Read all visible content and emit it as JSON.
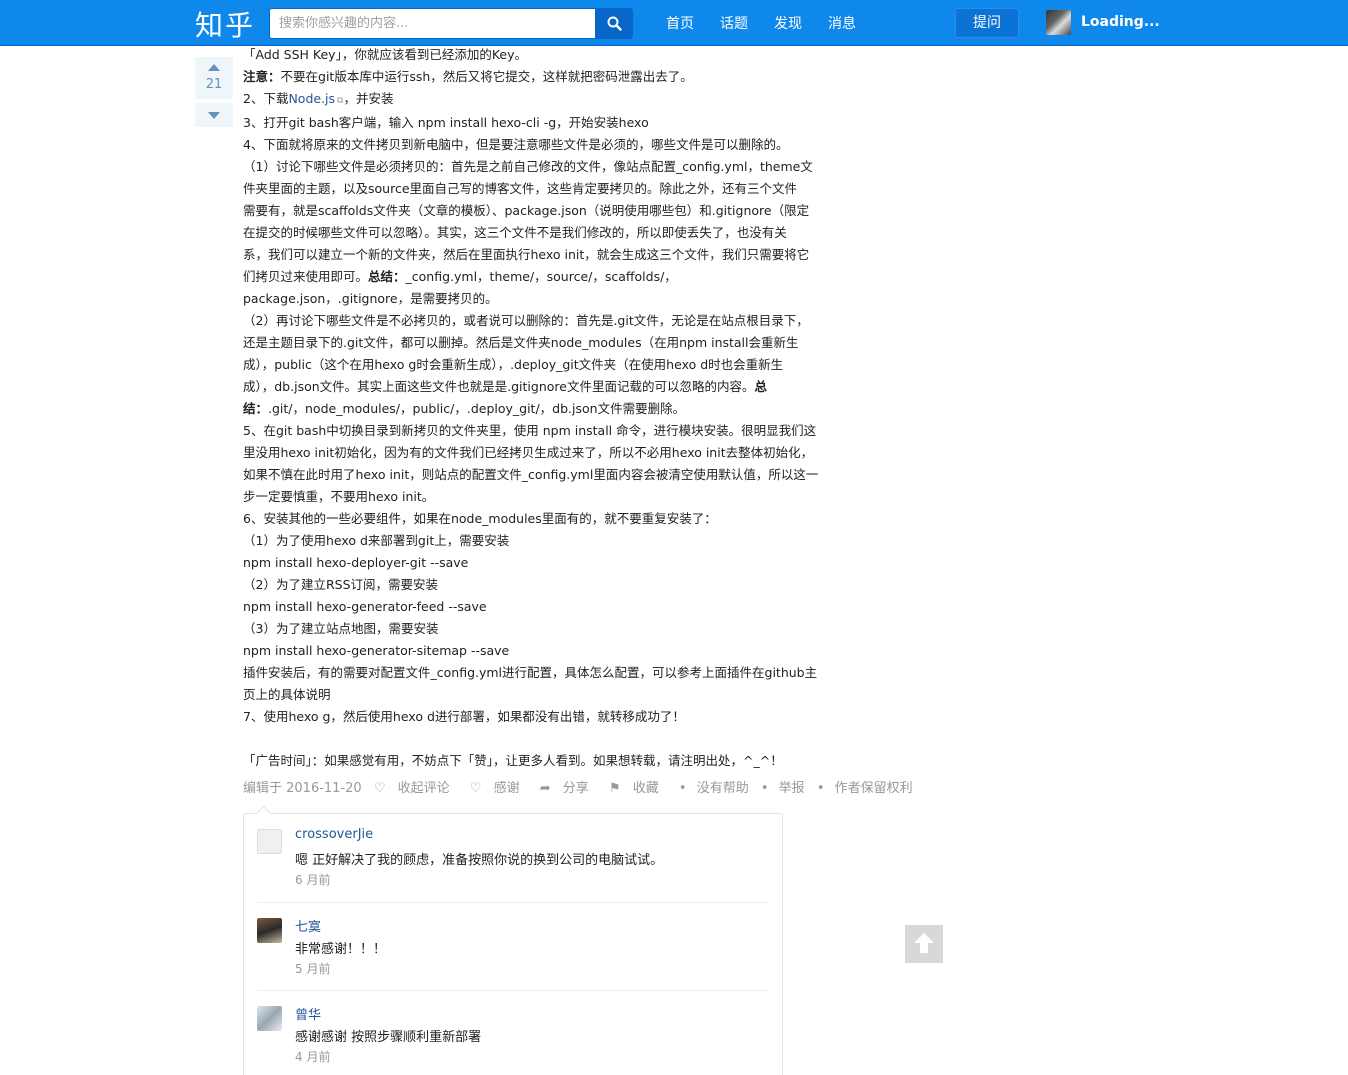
{
  "header": {
    "logo": "知乎",
    "search_placeholder": "搜索你感兴趣的内容...",
    "nav": [
      "首页",
      "话题",
      "发现",
      "消息"
    ],
    "ask_label": "提问",
    "user_name": "Loading...",
    "accent": "#0f88eb"
  },
  "vote": {
    "count": "21"
  },
  "article": {
    "l1": "「Add SSH Key」，你就应该看到已经添加的Key。",
    "l2_bold": "注意：",
    "l2": "不要在git版本库中运行ssh，然后又将它提交，这样就把密码泄露出去了。",
    "l3_pre": "2、下载",
    "l3_link": "Node.js",
    "l3_post": "，并安装",
    "l4": "3、打开git bash客户端，输入 npm install hexo-cli -g，开始安装hexo",
    "l5": "4、下面就将原来的文件拷贝到新电脑中，但是要注意哪些文件是必须的，哪些文件是可以删除的。",
    "l6": "（1）讨论下哪些文件是必须拷贝的：首先是之前自己修改的文件，像站点配置_config.yml，theme文",
    "l7": "件夹里面的主题，以及source里面自己写的博客文件，这些肯定要拷贝的。除此之外，还有三个文件",
    "l8": "需要有，就是scaffolds文件夹（文章的模板）、package.json（说明使用哪些包）和.gitignore（限定",
    "l9": "在提交的时候哪些文件可以忽略）。其实，这三个文件不是我们修改的，所以即使丢失了，也没有关",
    "l10": "系，我们可以建立一个新的文件夹，然后在里面执行hexo init，就会生成这三个文件，我们只需要将它",
    "l11_pre": "们拷贝过来使用即可。",
    "l11_bold": "总结：",
    "l11_post": "_config.yml，theme/，source/，scaffolds/，",
    "l12": "package.json，.gitignore，是需要拷贝的。",
    "l13": "（2）再讨论下哪些文件是不必拷贝的，或者说可以删除的：首先是.git文件，无论是在站点根目录下，",
    "l14": "还是主题目录下的.git文件，都可以删掉。然后是文件夹node_modules（在用npm install会重新生",
    "l15": "成），public（这个在用hexo g时会重新生成），.deploy_git文件夹（在使用hexo d时也会重新生",
    "l16_pre": "成），db.json文件。其实上面这些文件也就是是.gitignore文件里面记载的可以忽略的内容。",
    "l16_bold": "总",
    "l17_bold": "结：",
    "l17_post": ".git/，node_modules/，public/，.deploy_git/，db.json文件需要删除。",
    "l18": "5、在git bash中切换目录到新拷贝的文件夹里，使用 npm install 命令，进行模块安装。很明显我们这",
    "l19": "里没用hexo init初始化，因为有的文件我们已经拷贝生成过来了，所以不必用hexo init去整体初始化，",
    "l20": "如果不慎在此时用了hexo init，则站点的配置文件_config.yml里面内容会被清空使用默认值，所以这一",
    "l21": "步一定要慎重，不要用hexo init。",
    "l22": "6、安装其他的一些必要组件，如果在node_modules里面有的，就不要重复安装了：",
    "l23": "（1）为了使用hexo d来部署到git上，需要安装",
    "l24": "npm install hexo-deployer-git --save",
    "l25": "（2）为了建立RSS订阅，需要安装",
    "l26": "npm install hexo-generator-feed --save",
    "l27": "（3）为了建立站点地图，需要安装",
    "l28": "npm install hexo-generator-sitemap --save",
    "l29": "插件安装后，有的需要对配置文件_config.yml进行配置，具体怎么配置，可以参考上面插件在github主",
    "l30": "页上的具体说明",
    "l31": "7、使用hexo g，然后使用hexo d进行部署，如果都没有出错，就转移成功了！",
    "l32": "「广告时间」：如果感觉有用，不妨点下「赞」，让更多人看到。如果想转载，请注明出处，^_^！"
  },
  "meta": {
    "edited": "编辑于 2016-11-20",
    "collapse_comments": "收起评论",
    "thanks": "感谢",
    "share": "分享",
    "collect": "收藏",
    "no_help": "没有帮助",
    "report": "举报",
    "rights": "作者保留权利"
  },
  "comments": [
    {
      "name": "crossoverJie",
      "text": "嗯 正好解决了我的顾虑，准备按照你说的换到公司的电脑试试。",
      "time": "6 月前"
    },
    {
      "name": "七寞",
      "text": "非常感谢！！！",
      "time": "5 月前"
    },
    {
      "name": "曾华",
      "text": "感谢感谢 按照步骤顺利重新部署",
      "time": "4 月前"
    }
  ]
}
